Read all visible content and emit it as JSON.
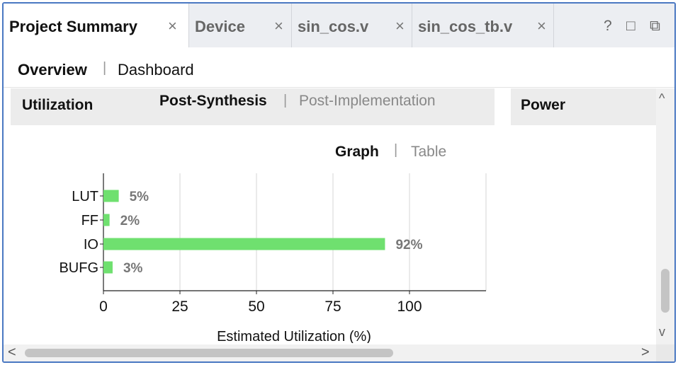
{
  "tabs": [
    {
      "label": "Project Summary",
      "close": "×",
      "active": true
    },
    {
      "label": "Device",
      "close": "×",
      "active": false
    },
    {
      "label": "sin_cos.v",
      "close": "×",
      "active": false
    },
    {
      "label": "sin_cos_tb.v",
      "close": "×",
      "active": false
    }
  ],
  "tab_tools": {
    "help": "?",
    "restore": "□",
    "float": "⧉"
  },
  "subnav": {
    "overview": "Overview",
    "dashboard": "Dashboard"
  },
  "utilization": {
    "title": "Utilization",
    "post_synthesis": "Post-Synthesis",
    "post_implementation": "Post-Implementation",
    "view_graph": "Graph",
    "view_table": "Table"
  },
  "power": {
    "title": "Power"
  },
  "separator": "|",
  "scroll_arrows": {
    "up": "^",
    "down": "v",
    "left": "<",
    "right": ">"
  },
  "chart_data": {
    "type": "bar",
    "orientation": "horizontal",
    "categories": [
      "LUT",
      "FF",
      "IO",
      "BUFG"
    ],
    "values": [
      5,
      2,
      92,
      3
    ],
    "value_labels": [
      "5%",
      "2%",
      "92%",
      "3%"
    ],
    "x_ticks": [
      0,
      25,
      50,
      75,
      100
    ],
    "xlim": [
      0,
      125
    ],
    "xlabel": "Estimated Utilization (%)",
    "bar_color": "#6fe06f",
    "grid": true
  }
}
